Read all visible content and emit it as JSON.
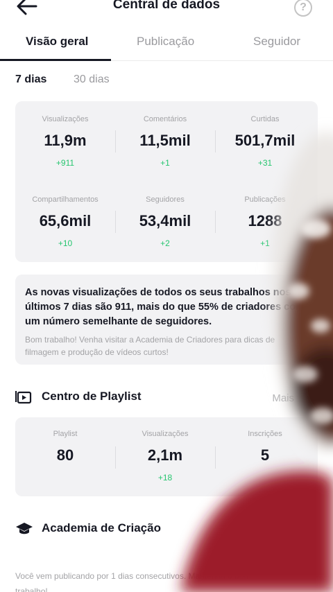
{
  "header": {
    "title": "Central de dados",
    "help_icon": "question-circle-icon",
    "back_icon": "arrow-left-icon"
  },
  "tabs": [
    {
      "label": "Visão geral",
      "active": true
    },
    {
      "label": "Publicação",
      "active": false
    },
    {
      "label": "Seguidor",
      "active": false
    }
  ],
  "period": {
    "active": "7 dias",
    "inactive": "30 dias"
  },
  "overview": [
    {
      "label": "Visualizações",
      "value": "11,9m",
      "delta": "+911"
    },
    {
      "label": "Comentários",
      "value": "11,5mil",
      "delta": "+1"
    },
    {
      "label": "Curtidas",
      "value": "501,7mil",
      "delta": "+31"
    },
    {
      "label": "Compartilhamentos",
      "value": "65,6mil",
      "delta": "+10"
    },
    {
      "label": "Seguidores",
      "value": "53,4mil",
      "delta": "+2"
    },
    {
      "label": "Publicações",
      "value": "1288",
      "delta": "+1"
    }
  ],
  "insight": {
    "line_prefix": "As novas visualizações de todos os seus trabalhos nos últimos 7 dias são ",
    "views": "911",
    "line_mid": ", mais do que ",
    "percent": "55%",
    "line_suffix": " de criadores com um número semelhante de seguidores.",
    "sub": "Bom trabalho! Venha visitar a Academia de Criadores para dicas de filmagem e produção de vídeos curtos!"
  },
  "playlist": {
    "title": "Centro de Playlist",
    "more": "Mais",
    "stats": [
      {
        "label": "Playlist",
        "value": "80",
        "delta": ""
      },
      {
        "label": "Visualizações",
        "value": "2,1m",
        "delta": "+18"
      },
      {
        "label": "Inscrições",
        "value": "5",
        "delta": ""
      }
    ]
  },
  "academy": {
    "title": "Academia de Criação"
  },
  "footer": {
    "text": "Você vem publicando por 1 dias consecutivos. Mantenha o bom",
    "text2": "trabalho!"
  },
  "colors": {
    "accent_green": "#25c56e",
    "card_bg": "#f2f2f4",
    "muted": "#a3a3a6"
  }
}
